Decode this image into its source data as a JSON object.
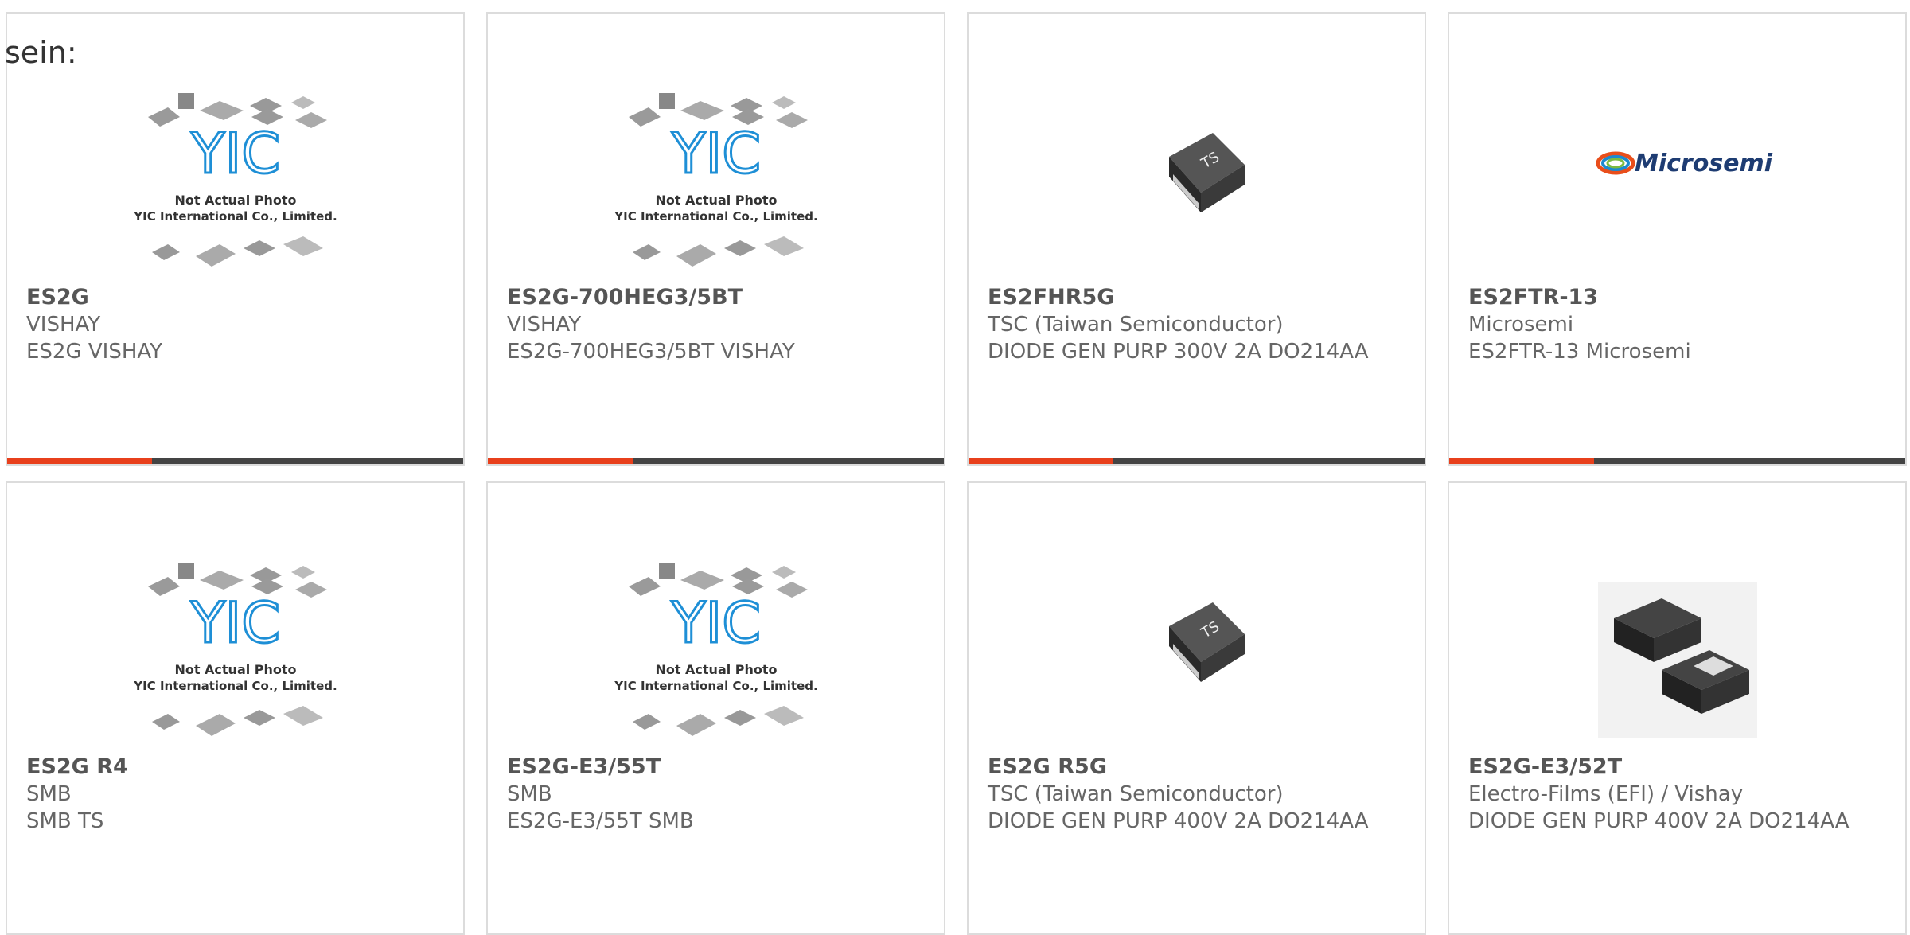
{
  "intro_text": "sein:",
  "accent_color": "#e8401c",
  "placeholder": {
    "line1": "Not Actual Photo",
    "line2": "YIC International Co., Limited.",
    "logo": "YIC"
  },
  "microsemi_logo_text": "Microsemi",
  "products": [
    {
      "part_number": "ES2G",
      "manufacturer": "VISHAY",
      "description": "ES2G VISHAY",
      "image": "yic-placeholder"
    },
    {
      "part_number": "ES2G-700HEG3/5BT",
      "manufacturer": "VISHAY",
      "description": "ES2G-700HEG3/5BT VISHAY",
      "image": "yic-placeholder"
    },
    {
      "part_number": "ES2FHR5G",
      "manufacturer": "TSC (Taiwan Semiconductor)",
      "description": "DIODE GEN PURP 300V 2A DO214AA",
      "image": "tsc-diode"
    },
    {
      "part_number": "ES2FTR-13",
      "manufacturer": "Microsemi",
      "description": "ES2FTR-13 Microsemi",
      "image": "microsemi-logo"
    },
    {
      "part_number": "ES2G R4",
      "manufacturer": "SMB",
      "description": "SMB TS",
      "image": "yic-placeholder"
    },
    {
      "part_number": "ES2G-E3/55T",
      "manufacturer": "SMB",
      "description": "ES2G-E3/55T SMB",
      "image": "yic-placeholder"
    },
    {
      "part_number": "ES2G R5G",
      "manufacturer": "TSC (Taiwan Semiconductor)",
      "description": "DIODE GEN PURP 400V 2A DO214AA",
      "image": "tsc-diode"
    },
    {
      "part_number": "ES2G-E3/52T",
      "manufacturer": "Electro-Films (EFI) / Vishay",
      "description": "DIODE GEN PURP 400V 2A DO214AA",
      "image": "smb-diode-pair"
    }
  ]
}
